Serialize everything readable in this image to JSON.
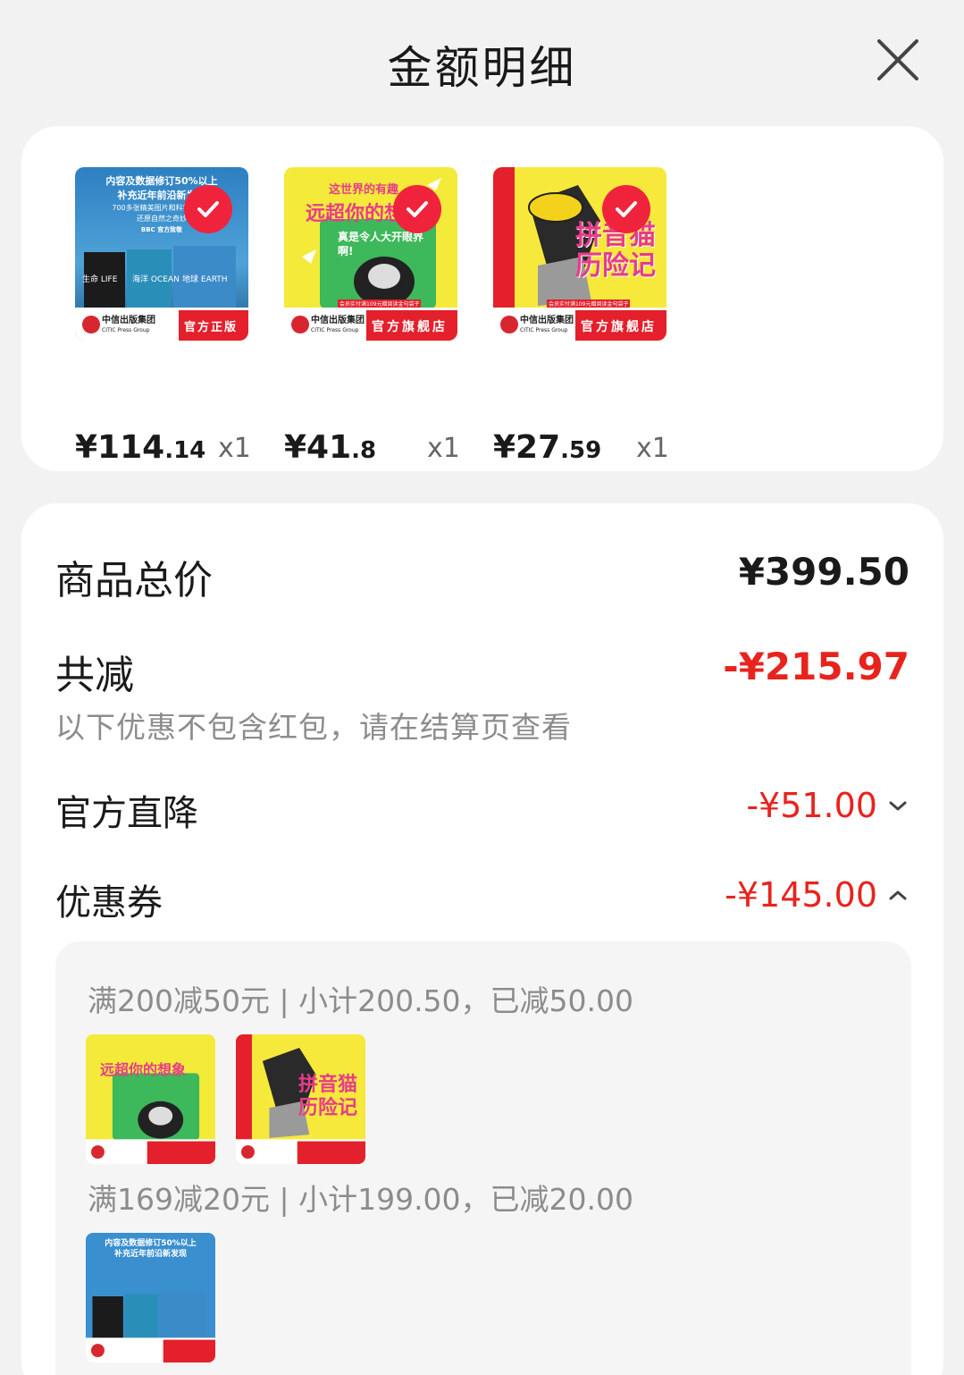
{
  "header": {
    "title": "金额明细"
  },
  "products": [
    {
      "price_int": "¥114",
      "price_dec": ".14",
      "qty": "x1",
      "cover_lines": [
        "内容及数据修订50%以上",
        "补充近年前沿新发现",
        "700多张精美图片和科学示意图",
        "还原自然之奇妙"
      ],
      "cover_tiles": [
        "生命 LIFE",
        "海洋 OCEAN",
        "地球 EARTH"
      ],
      "cover_brand": "BBC 官方致敬",
      "publisher": "中信出版集团",
      "publisher_en": "CITIC Press Group",
      "badge": "官方正版"
    },
    {
      "price_int": "¥41",
      "price_dec": ".8",
      "qty": "x1",
      "cover_top": "这世界的有趣",
      "cover_title": "远超你的想象",
      "cover_sub": "真是令人大开眼界啊!",
      "cover_promo": "会员实付满109元赠阅读金句袋子",
      "publisher": "中信出版集团",
      "publisher_en": "CITIC Press Group",
      "badge": "官方旗舰店"
    },
    {
      "price_int": "¥27",
      "price_dec": ".59",
      "qty": "x1",
      "cover_title_1": "拼音猫",
      "cover_title_2": "历险记",
      "cover_promo": "会员实付满109元赠阅读金句袋子",
      "publisher": "中信出版集团",
      "publisher_en": "CITIC Press Group",
      "badge": "官方旗舰店"
    }
  ],
  "summary": {
    "total_label": "商品总价",
    "total_value": "¥399.50",
    "discount_label": "共减",
    "discount_value": "-¥215.97",
    "note": "以下优惠不包含红包，请在结算页查看",
    "official_label": "官方直降",
    "official_value": "-¥51.00",
    "coupon_label": "优惠券",
    "coupon_value": "-¥145.00"
  },
  "coupons": [
    {
      "text": "满200减50元 | 小计200.50，已减50.00"
    },
    {
      "text": "满169减20元 | 小计199.00，已减20.00"
    }
  ],
  "colors": {
    "accent_red": "#e8231d",
    "check_red": "#f0233c",
    "background": "#f2f2f2"
  },
  "icons": [
    "close-icon",
    "check-icon",
    "chevron-down-icon",
    "chevron-up-icon"
  ]
}
